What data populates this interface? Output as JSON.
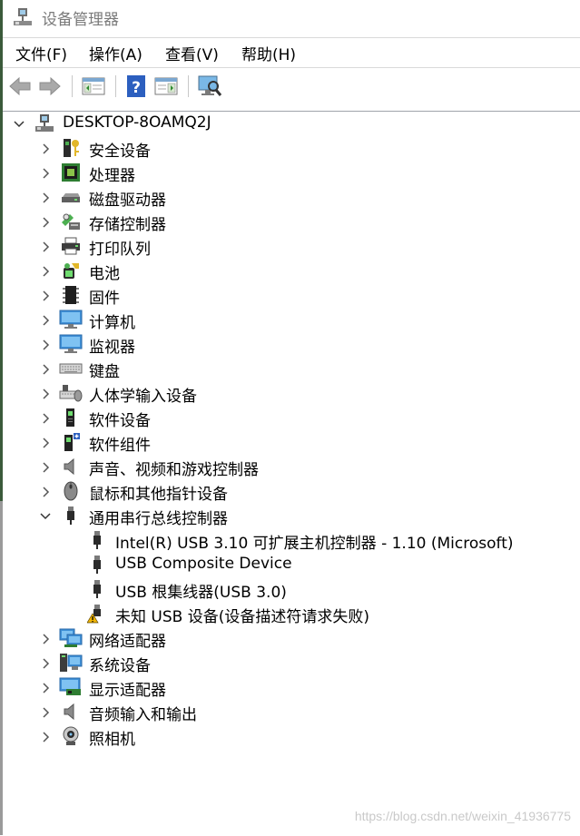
{
  "window": {
    "title": "设备管理器"
  },
  "menu": [
    {
      "label": "文件(F)"
    },
    {
      "label": "操作(A)"
    },
    {
      "label": "查看(V)"
    },
    {
      "label": "帮助(H)"
    }
  ],
  "toolbar": [
    {
      "icon": "back-arrow-icon"
    },
    {
      "icon": "forward-arrow-icon"
    },
    {
      "icon": "show-hide-console-tree-icon"
    },
    {
      "icon": "help-icon"
    },
    {
      "icon": "properties-pane-icon"
    },
    {
      "icon": "scan-hardware-changes-icon"
    }
  ],
  "tree": {
    "root": {
      "label": "DESKTOP-8OAMQ2J",
      "icon": "computer-icon",
      "expanded": true
    },
    "categories": [
      {
        "label": "安全设备",
        "icon": "security-device-icon"
      },
      {
        "label": "处理器",
        "icon": "processor-icon"
      },
      {
        "label": "磁盘驱动器",
        "icon": "disk-drive-icon"
      },
      {
        "label": "存储控制器",
        "icon": "storage-controller-icon"
      },
      {
        "label": "打印队列",
        "icon": "printer-icon"
      },
      {
        "label": "电池",
        "icon": "battery-icon"
      },
      {
        "label": "固件",
        "icon": "firmware-icon"
      },
      {
        "label": "计算机",
        "icon": "computer-monitor-icon"
      },
      {
        "label": "监视器",
        "icon": "monitor-icon"
      },
      {
        "label": "键盘",
        "icon": "keyboard-icon"
      },
      {
        "label": "人体学输入设备",
        "icon": "hid-icon"
      },
      {
        "label": "软件设备",
        "icon": "software-device-icon"
      },
      {
        "label": "软件组件",
        "icon": "software-component-icon"
      },
      {
        "label": "声音、视频和游戏控制器",
        "icon": "speaker-icon"
      },
      {
        "label": "鼠标和其他指针设备",
        "icon": "mouse-icon"
      },
      {
        "label": "通用串行总线控制器",
        "icon": "usb-controller-icon",
        "expanded": true,
        "children": [
          {
            "label": "Intel(R) USB 3.10 可扩展主机控制器 - 1.10 (Microsoft)",
            "icon": "usb-plug-icon"
          },
          {
            "label": "USB Composite Device",
            "icon": "usb-plug-icon"
          },
          {
            "label": "USB 根集线器(USB 3.0)",
            "icon": "usb-plug-icon"
          },
          {
            "label": "未知 USB 设备(设备描述符请求失败)",
            "icon": "usb-warning-icon"
          }
        ]
      },
      {
        "label": "网络适配器",
        "icon": "network-adapter-icon"
      },
      {
        "label": "系统设备",
        "icon": "system-device-icon"
      },
      {
        "label": "显示适配器",
        "icon": "display-adapter-icon"
      },
      {
        "label": "音频输入和输出",
        "icon": "audio-io-icon"
      },
      {
        "label": "照相机",
        "icon": "camera-icon"
      }
    ]
  },
  "watermark": "https://blog.csdn.net/weixin_41936775"
}
